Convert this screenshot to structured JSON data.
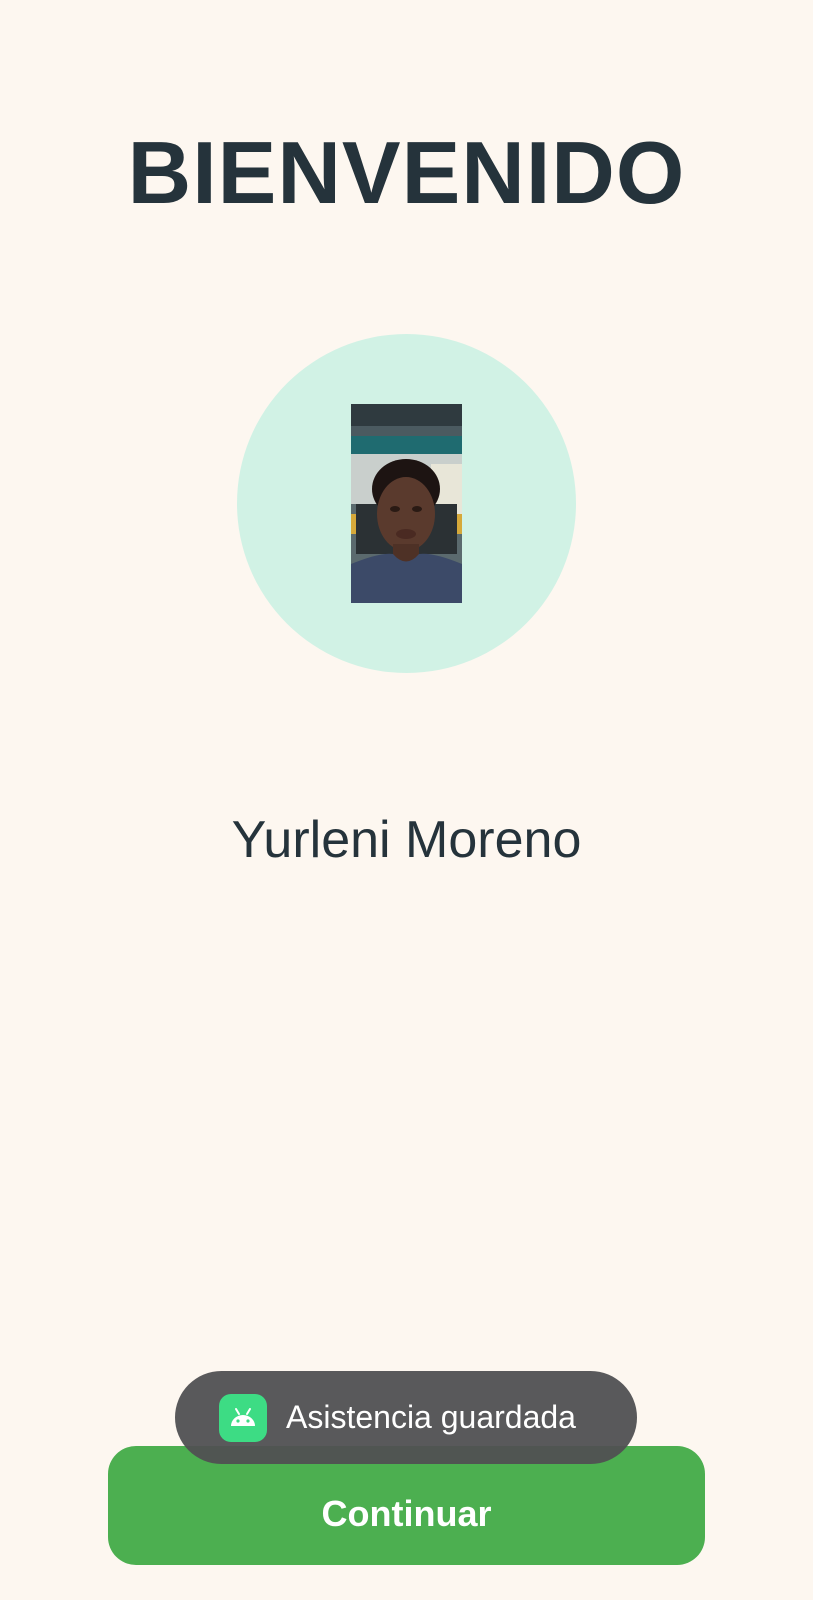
{
  "screen": {
    "title": "BIENVENIDO",
    "user_name": "Yurleni Moreno"
  },
  "avatar": {
    "icon": "user-photo"
  },
  "toast": {
    "icon": "android-robot-icon",
    "message": "Asistencia guardada"
  },
  "actions": {
    "continue_label": "Continuar"
  },
  "colors": {
    "background": "#fdf7f0",
    "title_text": "#25333b",
    "avatar_circle": "#d1f2e5",
    "button": "#4caf50",
    "toast_background": "#505052",
    "toast_icon": "#3ddc84"
  }
}
